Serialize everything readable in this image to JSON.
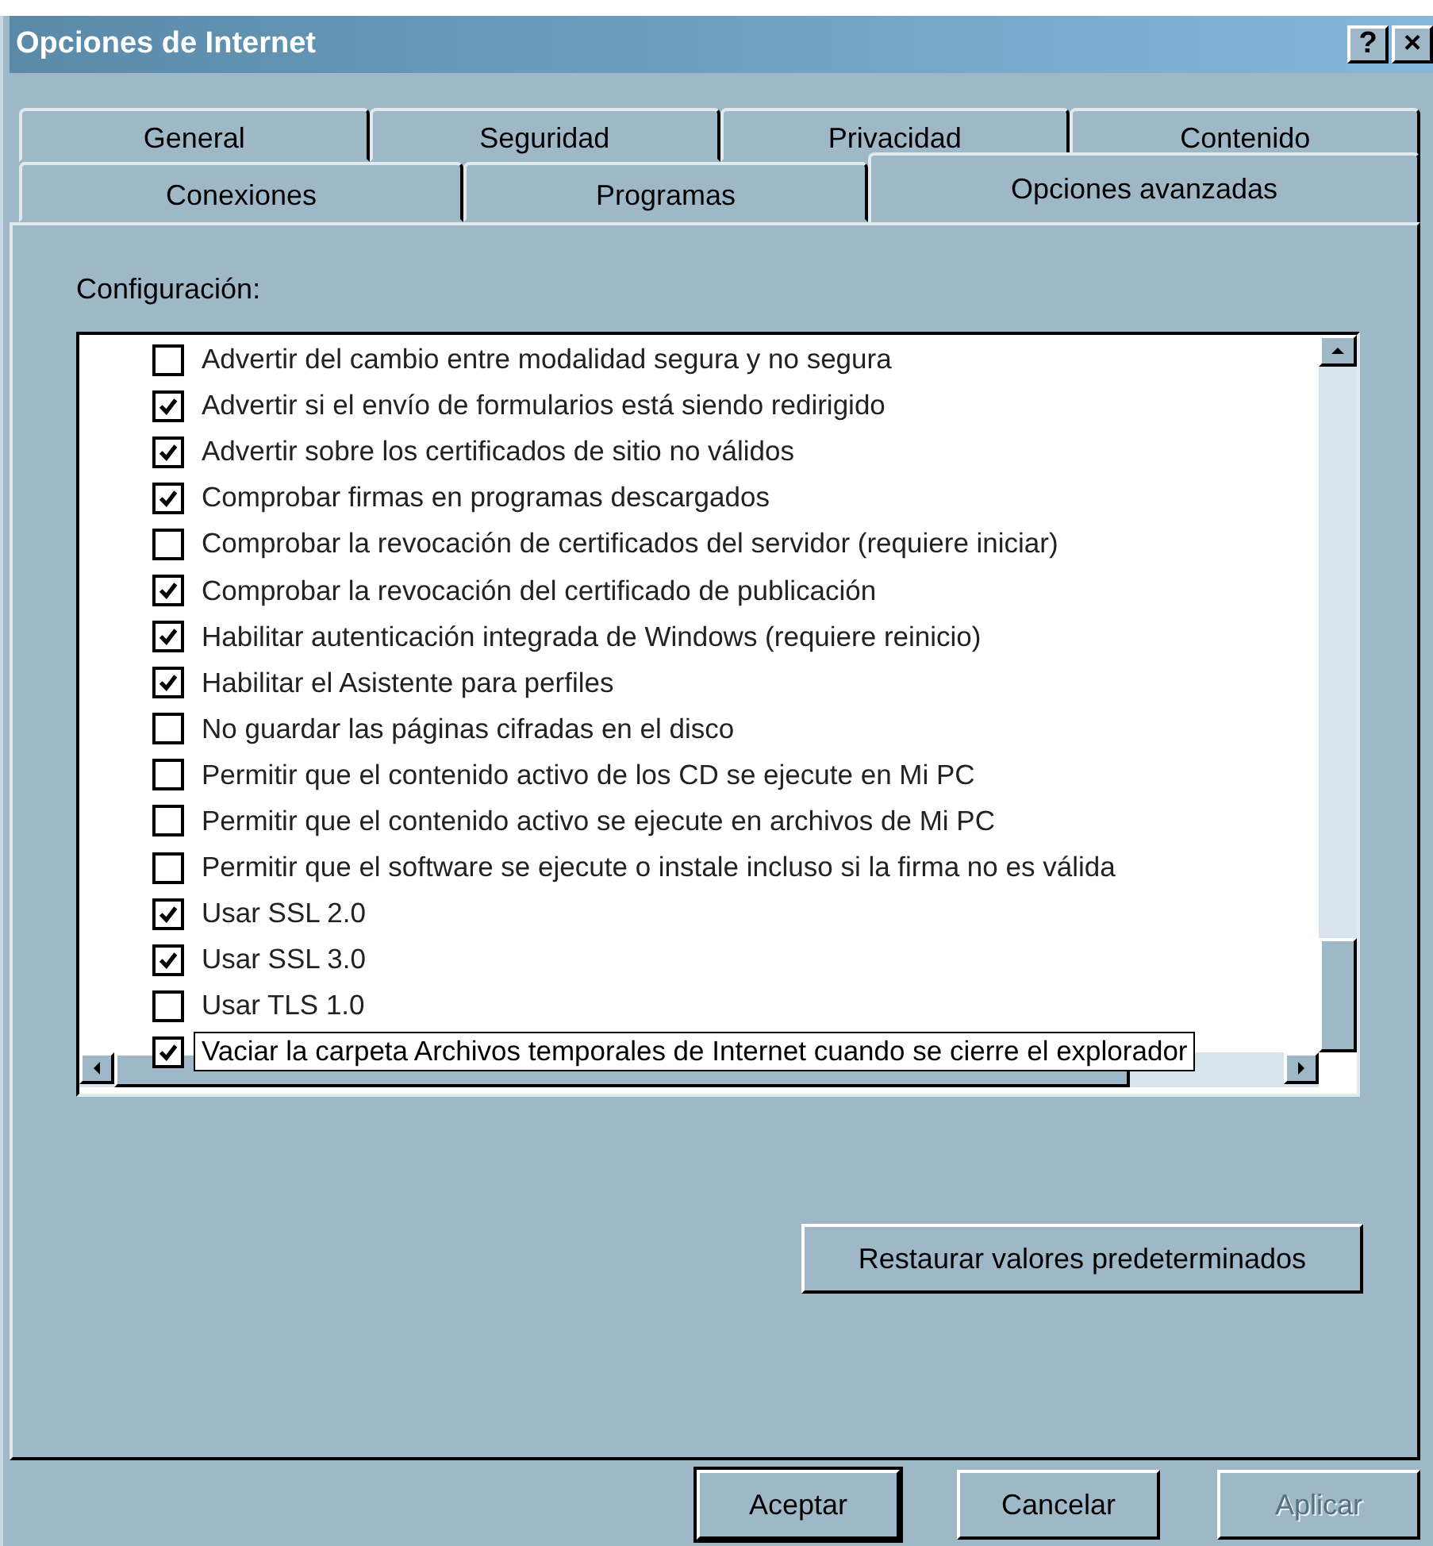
{
  "window": {
    "title": "Opciones de Internet",
    "help_button": "?",
    "close_button": "×"
  },
  "tab_rows": [
    [
      {
        "label": "General",
        "selected": false
      },
      {
        "label": "Seguridad",
        "selected": false
      },
      {
        "label": "Privacidad",
        "selected": false
      },
      {
        "label": "Contenido",
        "selected": false
      }
    ],
    [
      {
        "label": "Conexiones",
        "selected": false
      },
      {
        "label": "Programas",
        "selected": false
      },
      {
        "label": "Opciones avanzadas",
        "selected": true
      }
    ]
  ],
  "settings_label": "Configuración:",
  "settings": [
    {
      "label": "Advertir del cambio entre modalidad segura y no segura",
      "checked": false,
      "tooltip": false
    },
    {
      "label": "Advertir si el envío de formularios está siendo redirigido",
      "checked": true,
      "tooltip": false
    },
    {
      "label": "Advertir sobre los certificados de sitio no válidos",
      "checked": true,
      "tooltip": false
    },
    {
      "label": "Comprobar firmas en programas descargados",
      "checked": true,
      "tooltip": false
    },
    {
      "label": "Comprobar la revocación de certificados del servidor (requiere iniciar)",
      "checked": false,
      "tooltip": false
    },
    {
      "label": "Comprobar la revocación del certificado de publicación",
      "checked": true,
      "tooltip": false
    },
    {
      "label": "Habilitar autenticación integrada de Windows (requiere reinicio)",
      "checked": true,
      "tooltip": false
    },
    {
      "label": "Habilitar el Asistente para perfiles",
      "checked": true,
      "tooltip": false
    },
    {
      "label": "No guardar las páginas cifradas en el disco",
      "checked": false,
      "tooltip": false
    },
    {
      "label": "Permitir que el contenido activo de los CD se ejecute en Mi PC",
      "checked": false,
      "tooltip": false
    },
    {
      "label": "Permitir que el contenido activo se ejecute en archivos de Mi PC",
      "checked": false,
      "tooltip": false
    },
    {
      "label": "Permitir que el software se ejecute o instale incluso si la firma no es válida",
      "checked": false,
      "tooltip": false
    },
    {
      "label": "Usar SSL 2.0",
      "checked": true,
      "tooltip": false
    },
    {
      "label": "Usar SSL 3.0",
      "checked": true,
      "tooltip": false
    },
    {
      "label": "Usar TLS 1.0",
      "checked": false,
      "tooltip": false
    },
    {
      "label": "Vaciar la carpeta Archivos temporales de Internet cuando se cierre el explorador",
      "checked": true,
      "tooltip": true
    }
  ],
  "restore_button": "Restaurar valores predeterminados",
  "buttons": [
    {
      "label": "Aceptar",
      "disabled": false,
      "default": true
    },
    {
      "label": "Cancelar",
      "disabled": false,
      "default": false
    },
    {
      "label": "Aplicar",
      "disabled": true,
      "default": false
    }
  ]
}
